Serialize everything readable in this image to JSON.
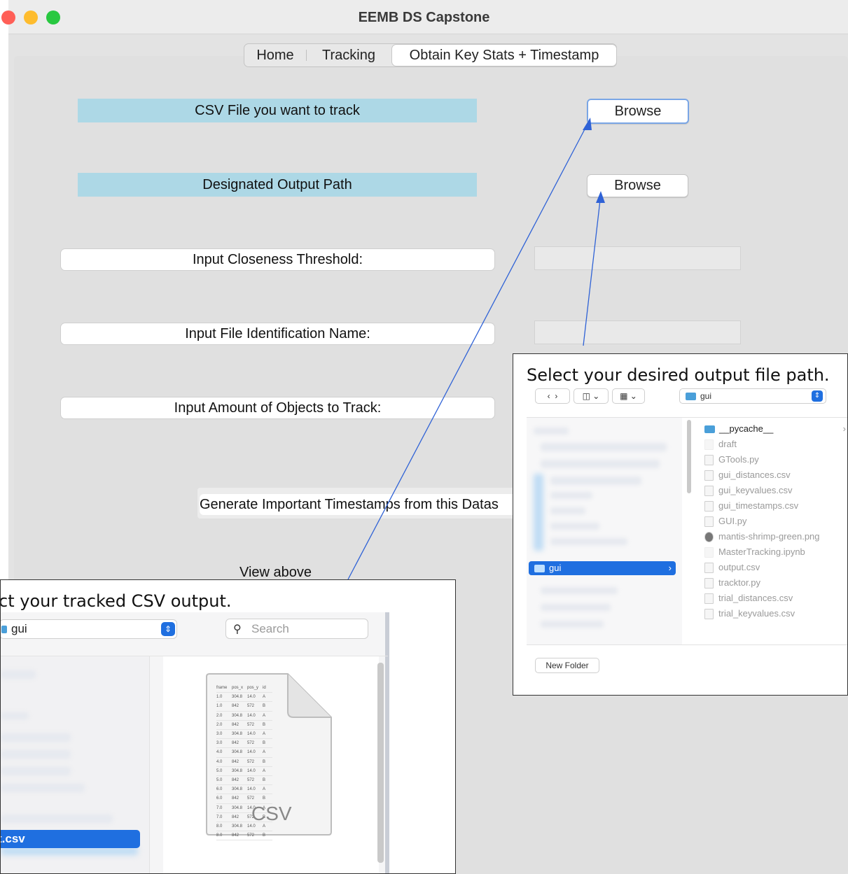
{
  "window": {
    "title": "EEMB DS Capstone"
  },
  "tabs": [
    {
      "label": "Home"
    },
    {
      "label": "Tracking"
    },
    {
      "label": "Obtain Key Stats + Timestamp"
    }
  ],
  "form": {
    "csv_label": "CSV File you want to track",
    "output_label": "Designated Output Path",
    "browse_label": "Browse",
    "closeness_label": "Input Closeness Threshold:",
    "identification_label": "Input File Identification Name:",
    "amount_label": "Input Amount of Objects to Track:",
    "generate_label": "Generate Important Timestamps from this Datas",
    "view_above": "View above"
  },
  "dialog_output": {
    "caption": "Select your desired output file path.",
    "folder": "gui",
    "sidebar_selected": "gui",
    "files": [
      {
        "name": "__pycache__",
        "kind": "folder"
      },
      {
        "name": "draft",
        "kind": "file"
      },
      {
        "name": "GTools.py",
        "kind": "file"
      },
      {
        "name": "gui_distances.csv",
        "kind": "file"
      },
      {
        "name": "gui_keyvalues.csv",
        "kind": "file"
      },
      {
        "name": "gui_timestamps.csv",
        "kind": "file"
      },
      {
        "name": "GUI.py",
        "kind": "file"
      },
      {
        "name": "mantis-shrimp-green.png",
        "kind": "image"
      },
      {
        "name": "MasterTracking.ipynb",
        "kind": "file"
      },
      {
        "name": "output.csv",
        "kind": "file"
      },
      {
        "name": "tracktor.py",
        "kind": "file"
      },
      {
        "name": "trial_distances.csv",
        "kind": "file"
      },
      {
        "name": "trial_keyvalues.csv",
        "kind": "file"
      }
    ],
    "new_folder_label": "New Folder"
  },
  "dialog_csv": {
    "caption": "ct your tracked CSV output.",
    "folder": "gui",
    "search_placeholder": "Search",
    "selected_file": "t.csv",
    "preview_label": "CSV",
    "preview_headers": [
      "frame",
      "pos_x",
      "pos_y",
      "id"
    ],
    "preview_rows": [
      [
        "1.0",
        "304.8",
        "14.0",
        "A"
      ],
      [
        "1.0",
        "842",
        "572",
        "B"
      ],
      [
        "2.0",
        "304.8",
        "14.0",
        "A"
      ],
      [
        "2.0",
        "842",
        "572",
        "B"
      ],
      [
        "3.0",
        "304.8",
        "14.0",
        "A"
      ],
      [
        "3.0",
        "842",
        "572",
        "B"
      ],
      [
        "4.0",
        "304.8",
        "14.0",
        "A"
      ],
      [
        "4.0",
        "842",
        "572",
        "B"
      ],
      [
        "5.0",
        "304.8",
        "14.0",
        "A"
      ],
      [
        "5.0",
        "842",
        "572",
        "B"
      ],
      [
        "6.0",
        "304.8",
        "14.0",
        "A"
      ],
      [
        "6.0",
        "842",
        "572",
        "B"
      ],
      [
        "7.0",
        "304.8",
        "14.0",
        "A"
      ],
      [
        "7.0",
        "842",
        "572",
        "B"
      ],
      [
        "8.0",
        "304.8",
        "14.0",
        "A"
      ],
      [
        "8.0",
        "842",
        "572",
        "B"
      ]
    ]
  },
  "colors": {
    "label_blue": "#add8e6",
    "selection_blue": "#1f6fe0",
    "traffic_red": "#ff5f57",
    "traffic_yellow": "#febc2e",
    "traffic_green": "#28c840",
    "arrow_blue": "#2f62d6"
  }
}
